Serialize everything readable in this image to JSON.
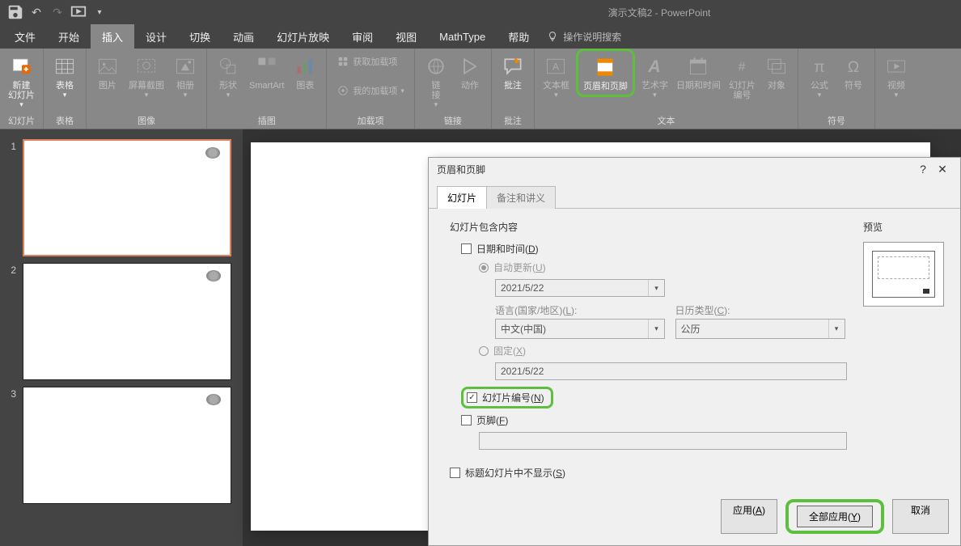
{
  "window_title": "演示文稿2 - PowerPoint",
  "ribbon_tabs": [
    "文件",
    "开始",
    "插入",
    "设计",
    "切换",
    "动画",
    "幻灯片放映",
    "审阅",
    "视图",
    "MathType",
    "帮助"
  ],
  "ribbon_help": "操作说明搜索",
  "active_tab_index": 2,
  "ribbon": {
    "group1": {
      "label": "幻灯片",
      "btn": "新建\n幻灯片"
    },
    "group2": {
      "label": "表格",
      "btn": "表格"
    },
    "group3": {
      "label": "图像",
      "btns": [
        "图片",
        "屏幕截图",
        "相册"
      ]
    },
    "group4": {
      "label": "插图",
      "btns": [
        "形状",
        "SmartArt",
        "图表"
      ]
    },
    "group5": {
      "label": "加载项",
      "items": [
        "获取加载项",
        "我的加载项"
      ]
    },
    "group6": {
      "label": "链接",
      "btns": [
        "链接",
        "动作"
      ]
    },
    "group7": {
      "label": "批注",
      "btn": "批注"
    },
    "group8": {
      "label": "文本",
      "btns": [
        "文本框",
        "页眉和页脚",
        "艺术字",
        "日期和时间",
        "幻灯片编号",
        "对象"
      ]
    },
    "group9": {
      "label": "符号",
      "btns": [
        "公式",
        "符号"
      ]
    },
    "group10": {
      "label": "",
      "btn": "视频"
    }
  },
  "dialog": {
    "title": "页眉和页脚",
    "tabs": [
      "幻灯片",
      "备注和讲义"
    ],
    "content_title": "幻灯片包含内容",
    "preview_label": "预览",
    "date_time": "日期和时间(D)",
    "auto_update": "自动更新(U)",
    "date_value": "2021/5/22",
    "lang_label": "语言(国家/地区)(L):",
    "lang_value": "中文(中国)",
    "cal_label": "日历类型(C):",
    "cal_value": "公历",
    "fixed": "固定(X)",
    "fixed_date": "2021/5/22",
    "slide_number": "幻灯片编号(N)",
    "footer": "页脚(F)",
    "dont_show_title": "标题幻灯片中不显示(S)",
    "btn_apply": "应用(A)",
    "btn_apply_all": "全部应用(Y)",
    "btn_cancel": "取消"
  }
}
